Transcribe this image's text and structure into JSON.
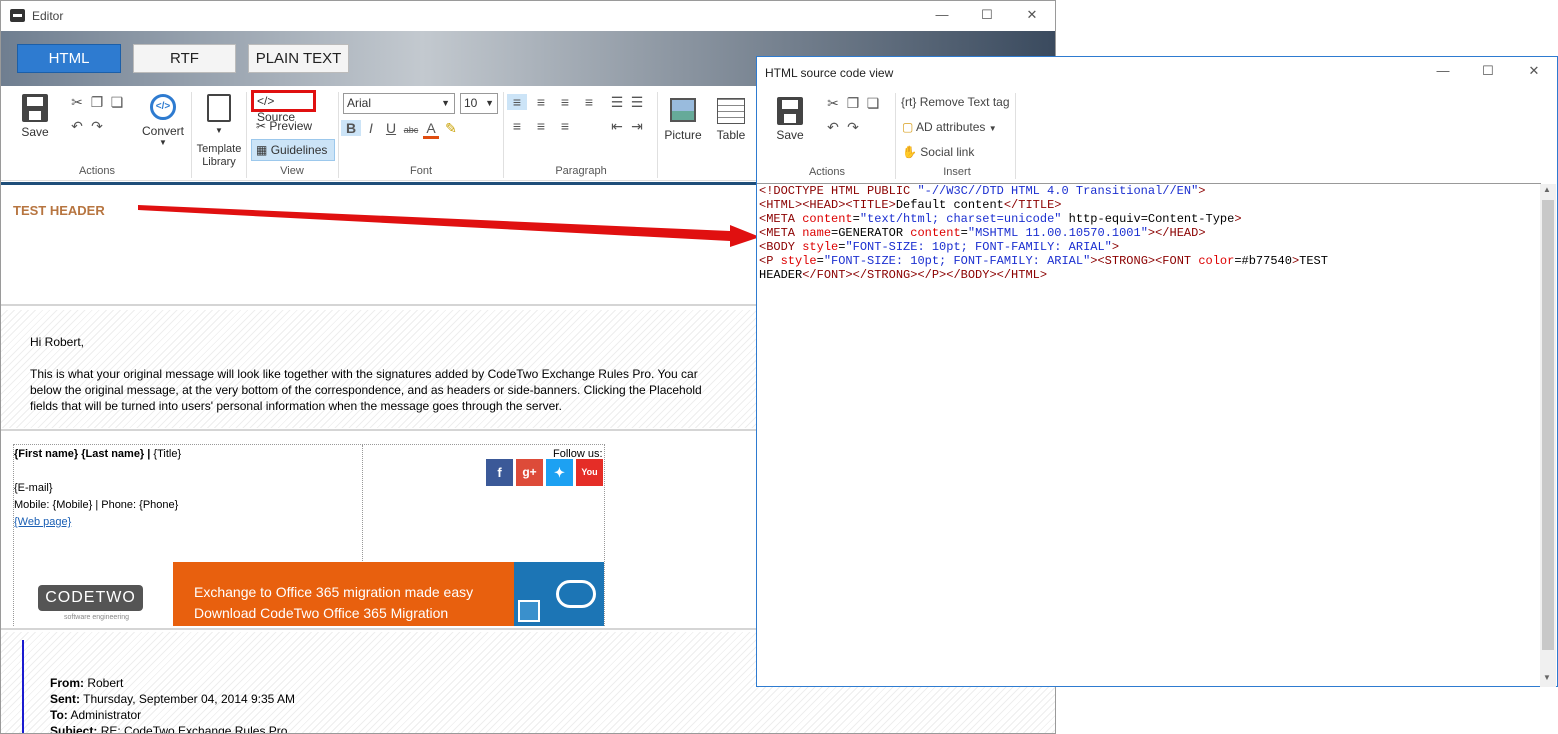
{
  "editor": {
    "title": "Editor",
    "modes": [
      "HTML",
      "RTF",
      "PLAIN TEXT"
    ],
    "ribbon": {
      "save": "Save",
      "convert": "Convert",
      "template_library": "Template Library",
      "source": "Source",
      "preview": "Preview",
      "guidelines": "Guidelines",
      "font_name": "Arial",
      "font_size": "10",
      "picture": "Picture",
      "table": "Table",
      "groups": [
        "Actions",
        "View",
        "Font",
        "Paragraph"
      ]
    },
    "content": {
      "test_header": "TEST HEADER",
      "greeting": "Hi Robert,",
      "body_lines": [
        "This is what your original message will look like together with the signatures added by CodeTwo Exchange Rules Pro. You car",
        "below the original message, at the very bottom of the correspondence, and as headers or side-banners. Clicking the Placehold",
        "fields that will be turned into users' personal information when the message goes through the server."
      ],
      "sig_name": "{First name} {Last name}",
      "sig_sep": " | ",
      "sig_title": "{Title}",
      "sig_email": "{E-mail}",
      "sig_phones": "Mobile: {Mobile} | Phone: {Phone}",
      "sig_web": "{Web page}",
      "follow_us": "Follow us:",
      "logo_text": "CODETWO",
      "logo_sub": "software engineering",
      "banner_line1": "Exchange to Office 365 migration made easy",
      "banner_line2": "Download CodeTwo Office 365 Migration",
      "reply": [
        {
          "label": "From:",
          "value": "Robert"
        },
        {
          "label": "Sent:",
          "value": "Thursday, September 04, 2014 9:35 AM"
        },
        {
          "label": "To:",
          "value": "Administrator"
        },
        {
          "label": "Subject:",
          "value": "RE: CodeTwo Exchange Rules Pro"
        }
      ]
    }
  },
  "source_view": {
    "title": "HTML source code view",
    "save": "Save",
    "remove_text_tag": "Remove Text tag",
    "remove_prefix": "{rt}",
    "ad_attributes": "AD attributes",
    "social_link": "Social link",
    "groups": [
      "Actions",
      "Insert"
    ]
  },
  "colors": {
    "accent": "#2e7bd0",
    "header_text": "#b77540",
    "arrow": "#e01010",
    "banner_orange": "#e8600e",
    "banner_blue": "#1c75b5"
  }
}
